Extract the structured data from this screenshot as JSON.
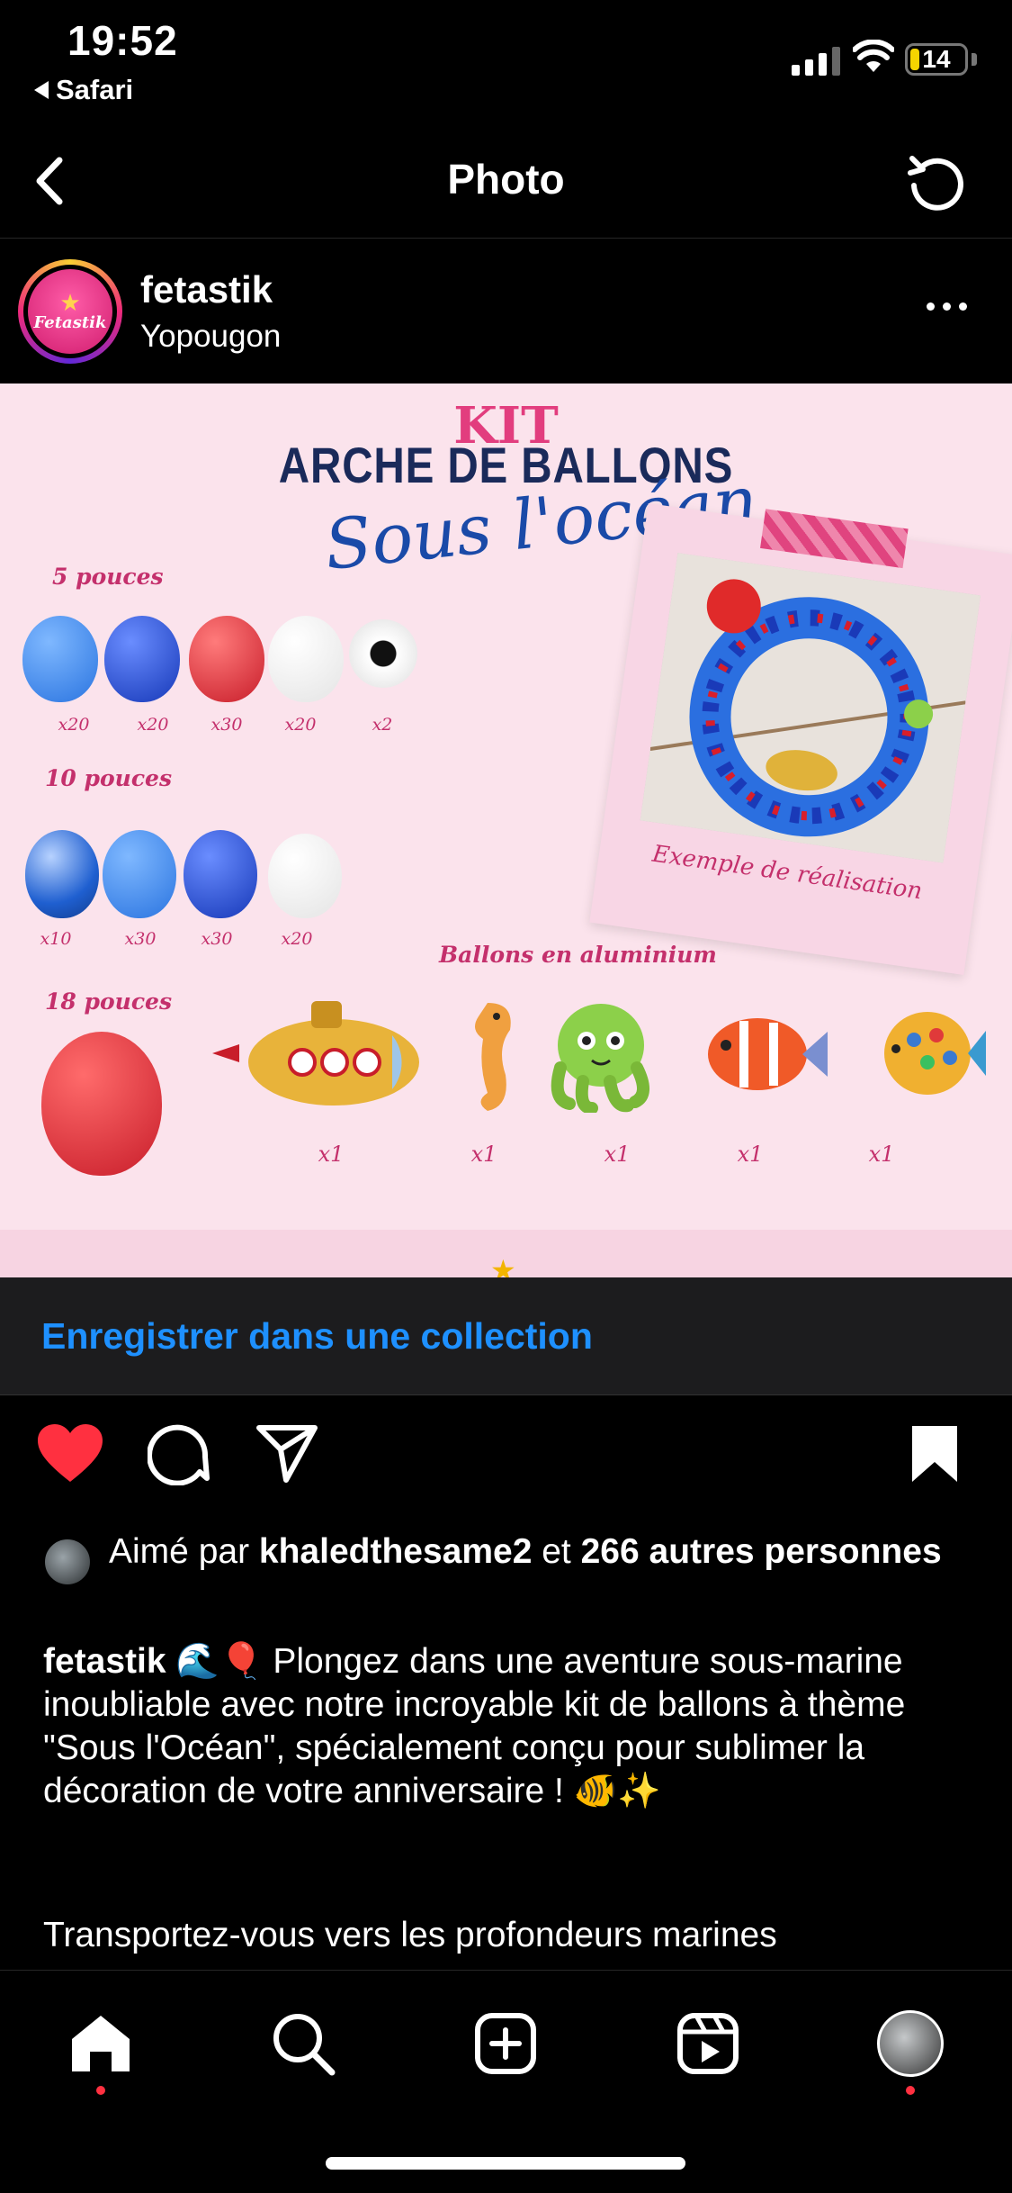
{
  "status": {
    "time": "19:52",
    "back_app": "Safari",
    "battery": "14"
  },
  "nav": {
    "title": "Photo"
  },
  "post": {
    "username": "fetastik",
    "location": "Yopougon",
    "avatar_text": "Fetastik"
  },
  "image": {
    "kit": "KIT",
    "arche": "ARCHE DE BALLONS",
    "sous": "Sous l'océan",
    "size_5": "5 pouces",
    "size_10": "10 pouces",
    "size_18": "18 pouces",
    "qty_5": [
      "x20",
      "x20",
      "x30",
      "x20",
      "x2"
    ],
    "qty_10": [
      "x10",
      "x30",
      "x30",
      "x20"
    ],
    "alu_label": "Ballons en aluminium",
    "qty_alu": [
      "x1",
      "x1",
      "x1",
      "x1",
      "x1"
    ],
    "example_caption": "Exemple de réalisation"
  },
  "save_banner": {
    "label": "Enregistrer dans une collection"
  },
  "likes": {
    "prefix": "Aimé par ",
    "user": "khaledthesame2",
    "middle": " et ",
    "others": "266 autres personnes"
  },
  "caption": {
    "user": "fetastik",
    "emoji_after_user": " 🌊🎈 ",
    "text": "Plongez dans une aventure sous-marine inoubliable avec notre incroyable kit de ballons à thème \"Sous l'Océan\", spécialement conçu pour sublimer la décoration de votre anniversaire ! 🐠✨",
    "text_2": "Transportez-vous vers les profondeurs marines"
  },
  "colors": {
    "link_blue": "#1e90ff",
    "like_red": "#ff3040",
    "brand_pink": "#e23d7e",
    "image_bg": "#fbe3ec"
  },
  "icons": {
    "back": "chevron-left-icon",
    "refresh": "refresh-icon",
    "more": "more-dots-icon",
    "like": "heart-icon",
    "comment": "comment-icon",
    "share": "send-icon",
    "save": "bookmark-icon",
    "home": "home-icon",
    "search": "search-icon",
    "create": "plus-square-icon",
    "reels": "reels-icon"
  }
}
